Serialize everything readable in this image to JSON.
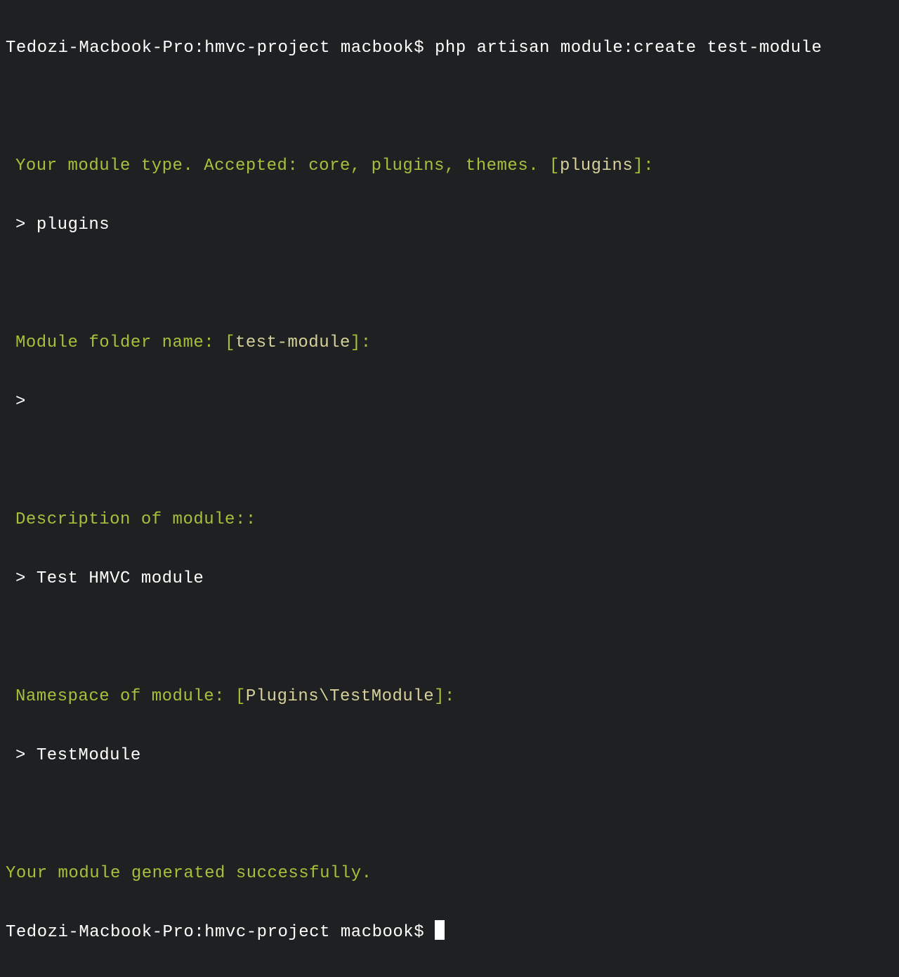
{
  "terminal": {
    "prompt_host": "Tedozi-Macbook-Pro:",
    "prompt_dir": "hmvc-project",
    "prompt_user": "macbook$",
    "command": "php artisan module:create test-module",
    "prompts": [
      {
        "question_pre": "Your module type. Accepted: core, plugins, themes.",
        "bracket_open": "[",
        "default": "plugins",
        "bracket_close": "]:",
        "answer_marker": ">",
        "answer": "plugins"
      },
      {
        "question_pre": "Module folder name:",
        "bracket_open": "[",
        "default": "test-module",
        "bracket_close": "]:",
        "answer_marker": ">",
        "answer": ""
      },
      {
        "question_pre": "Description of module::",
        "bracket_open": "",
        "default": "",
        "bracket_close": "",
        "answer_marker": ">",
        "answer": "Test HMVC module"
      },
      {
        "question_pre": "Namespace of module:",
        "bracket_open": "[",
        "default": "Plugins\\TestModule",
        "bracket_close": "]:",
        "answer_marker": ">",
        "answer": "TestModule"
      }
    ],
    "success_message": "Your module generated successfully."
  }
}
